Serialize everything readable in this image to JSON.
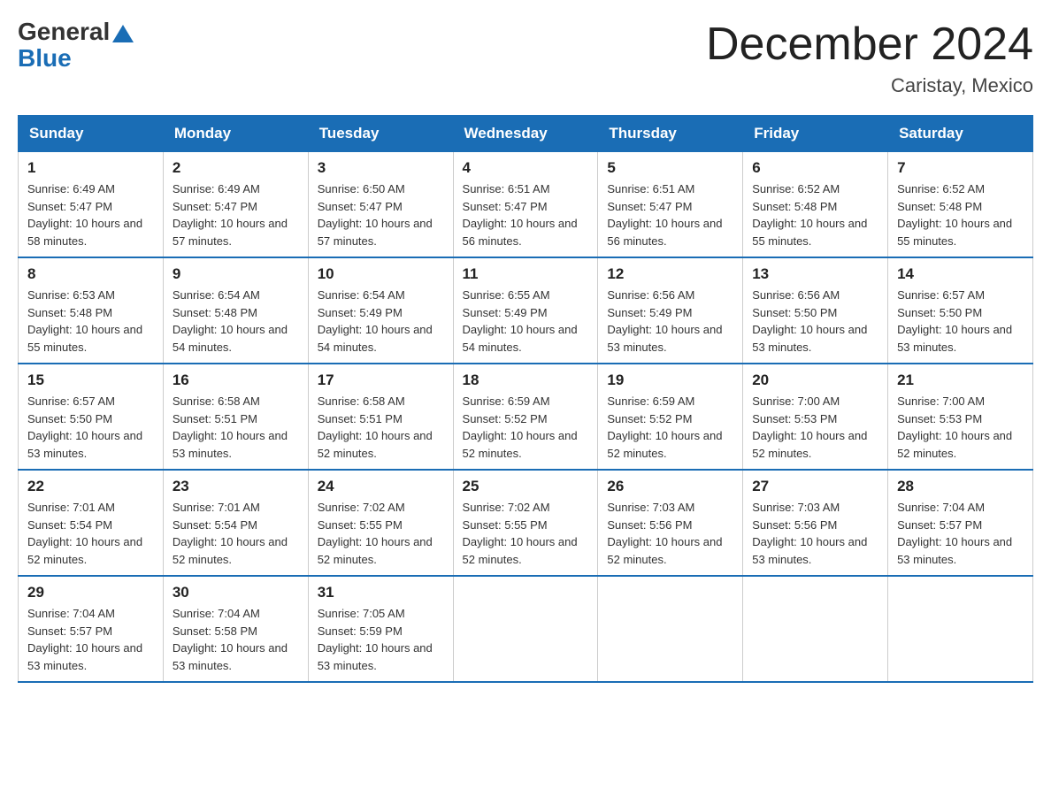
{
  "logo": {
    "general": "General",
    "blue": "Blue"
  },
  "header": {
    "month_title": "December 2024",
    "location": "Caristay, Mexico"
  },
  "days_of_week": [
    "Sunday",
    "Monday",
    "Tuesday",
    "Wednesday",
    "Thursday",
    "Friday",
    "Saturday"
  ],
  "weeks": [
    [
      {
        "day": "1",
        "sunrise": "6:49 AM",
        "sunset": "5:47 PM",
        "daylight": "10 hours and 58 minutes."
      },
      {
        "day": "2",
        "sunrise": "6:49 AM",
        "sunset": "5:47 PM",
        "daylight": "10 hours and 57 minutes."
      },
      {
        "day": "3",
        "sunrise": "6:50 AM",
        "sunset": "5:47 PM",
        "daylight": "10 hours and 57 minutes."
      },
      {
        "day": "4",
        "sunrise": "6:51 AM",
        "sunset": "5:47 PM",
        "daylight": "10 hours and 56 minutes."
      },
      {
        "day": "5",
        "sunrise": "6:51 AM",
        "sunset": "5:47 PM",
        "daylight": "10 hours and 56 minutes."
      },
      {
        "day": "6",
        "sunrise": "6:52 AM",
        "sunset": "5:48 PM",
        "daylight": "10 hours and 55 minutes."
      },
      {
        "day": "7",
        "sunrise": "6:52 AM",
        "sunset": "5:48 PM",
        "daylight": "10 hours and 55 minutes."
      }
    ],
    [
      {
        "day": "8",
        "sunrise": "6:53 AM",
        "sunset": "5:48 PM",
        "daylight": "10 hours and 55 minutes."
      },
      {
        "day": "9",
        "sunrise": "6:54 AM",
        "sunset": "5:48 PM",
        "daylight": "10 hours and 54 minutes."
      },
      {
        "day": "10",
        "sunrise": "6:54 AM",
        "sunset": "5:49 PM",
        "daylight": "10 hours and 54 minutes."
      },
      {
        "day": "11",
        "sunrise": "6:55 AM",
        "sunset": "5:49 PM",
        "daylight": "10 hours and 54 minutes."
      },
      {
        "day": "12",
        "sunrise": "6:56 AM",
        "sunset": "5:49 PM",
        "daylight": "10 hours and 53 minutes."
      },
      {
        "day": "13",
        "sunrise": "6:56 AM",
        "sunset": "5:50 PM",
        "daylight": "10 hours and 53 minutes."
      },
      {
        "day": "14",
        "sunrise": "6:57 AM",
        "sunset": "5:50 PM",
        "daylight": "10 hours and 53 minutes."
      }
    ],
    [
      {
        "day": "15",
        "sunrise": "6:57 AM",
        "sunset": "5:50 PM",
        "daylight": "10 hours and 53 minutes."
      },
      {
        "day": "16",
        "sunrise": "6:58 AM",
        "sunset": "5:51 PM",
        "daylight": "10 hours and 53 minutes."
      },
      {
        "day": "17",
        "sunrise": "6:58 AM",
        "sunset": "5:51 PM",
        "daylight": "10 hours and 52 minutes."
      },
      {
        "day": "18",
        "sunrise": "6:59 AM",
        "sunset": "5:52 PM",
        "daylight": "10 hours and 52 minutes."
      },
      {
        "day": "19",
        "sunrise": "6:59 AM",
        "sunset": "5:52 PM",
        "daylight": "10 hours and 52 minutes."
      },
      {
        "day": "20",
        "sunrise": "7:00 AM",
        "sunset": "5:53 PM",
        "daylight": "10 hours and 52 minutes."
      },
      {
        "day": "21",
        "sunrise": "7:00 AM",
        "sunset": "5:53 PM",
        "daylight": "10 hours and 52 minutes."
      }
    ],
    [
      {
        "day": "22",
        "sunrise": "7:01 AM",
        "sunset": "5:54 PM",
        "daylight": "10 hours and 52 minutes."
      },
      {
        "day": "23",
        "sunrise": "7:01 AM",
        "sunset": "5:54 PM",
        "daylight": "10 hours and 52 minutes."
      },
      {
        "day": "24",
        "sunrise": "7:02 AM",
        "sunset": "5:55 PM",
        "daylight": "10 hours and 52 minutes."
      },
      {
        "day": "25",
        "sunrise": "7:02 AM",
        "sunset": "5:55 PM",
        "daylight": "10 hours and 52 minutes."
      },
      {
        "day": "26",
        "sunrise": "7:03 AM",
        "sunset": "5:56 PM",
        "daylight": "10 hours and 52 minutes."
      },
      {
        "day": "27",
        "sunrise": "7:03 AM",
        "sunset": "5:56 PM",
        "daylight": "10 hours and 53 minutes."
      },
      {
        "day": "28",
        "sunrise": "7:04 AM",
        "sunset": "5:57 PM",
        "daylight": "10 hours and 53 minutes."
      }
    ],
    [
      {
        "day": "29",
        "sunrise": "7:04 AM",
        "sunset": "5:57 PM",
        "daylight": "10 hours and 53 minutes."
      },
      {
        "day": "30",
        "sunrise": "7:04 AM",
        "sunset": "5:58 PM",
        "daylight": "10 hours and 53 minutes."
      },
      {
        "day": "31",
        "sunrise": "7:05 AM",
        "sunset": "5:59 PM",
        "daylight": "10 hours and 53 minutes."
      },
      null,
      null,
      null,
      null
    ]
  ]
}
